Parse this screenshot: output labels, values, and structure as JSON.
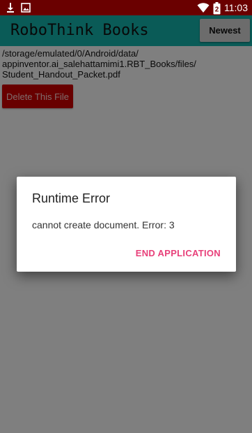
{
  "status_bar": {
    "time": "11:03",
    "battery_level": "2",
    "icons": [
      "download-icon",
      "image-icon",
      "wifi-icon",
      "battery-icon"
    ],
    "background": "#6a0000"
  },
  "app_bar": {
    "title": "RoboThink Books",
    "newest_label": "Newest",
    "background": "#14b6ae"
  },
  "content": {
    "file_path_lines": [
      "/storage/emulated/0/Android/data/",
      "appinventor.ai_salehattamimi1.RBT_Books/files/",
      "Student_Handout_Packet.pdf"
    ],
    "delete_label": "Delete This File",
    "delete_color": "#d10000"
  },
  "dialog": {
    "title": "Runtime Error",
    "message": "cannot create document. Error: 3",
    "action_label": "END APPLICATION",
    "action_color": "#e8407a"
  }
}
